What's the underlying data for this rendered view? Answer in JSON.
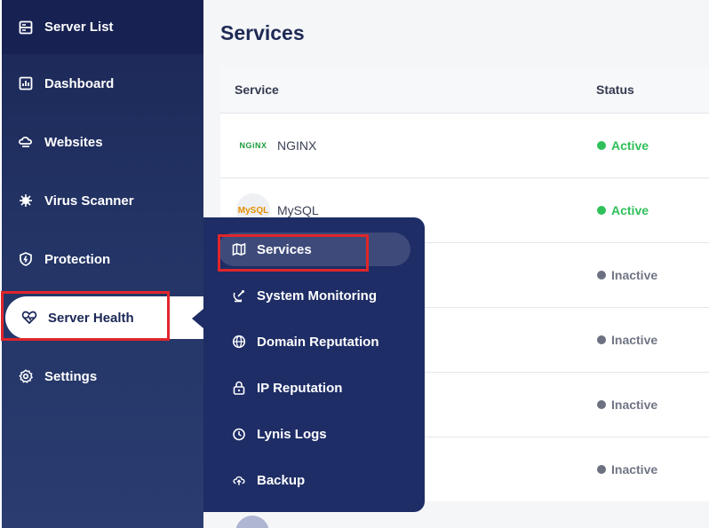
{
  "sidebar": {
    "items": [
      {
        "label": "Server List",
        "icon": "server-list-icon"
      },
      {
        "label": "Dashboard",
        "icon": "chart-icon"
      },
      {
        "label": "Websites",
        "icon": "cloud-icon"
      },
      {
        "label": "Virus Scanner",
        "icon": "virus-icon"
      },
      {
        "label": "Protection",
        "icon": "shield-icon"
      },
      {
        "label": "Server Health",
        "icon": "heart-pulse-icon"
      },
      {
        "label": "Settings",
        "icon": "gear-icon"
      }
    ]
  },
  "main": {
    "title": "Services",
    "table": {
      "headers": {
        "service": "Service",
        "status": "Status"
      },
      "rows": [
        {
          "service": "NGINX",
          "logo": "NGiNX",
          "status": "Active"
        },
        {
          "service": "MySQL",
          "logo": "MySQL",
          "status": "Active"
        },
        {
          "service": "",
          "status": "Inactive"
        },
        {
          "service": "",
          "status": "Inactive"
        },
        {
          "service": "",
          "status": "Inactive"
        },
        {
          "service": "",
          "status": "Inactive"
        }
      ]
    }
  },
  "flyout": {
    "items": [
      {
        "label": "Services",
        "icon": "map-icon"
      },
      {
        "label": "System Monitoring",
        "icon": "satellite-icon"
      },
      {
        "label": "Domain Reputation",
        "icon": "globe-icon"
      },
      {
        "label": "IP Reputation",
        "icon": "lock-icon"
      },
      {
        "label": "Lynis Logs",
        "icon": "history-icon"
      },
      {
        "label": "Backup",
        "icon": "cloud-upload-icon"
      }
    ]
  },
  "colors": {
    "sidebar_bg": "#1b2756",
    "flyout_bg": "#1e2d66",
    "active_status": "#2fc05a",
    "inactive_status": "#707585",
    "highlight": "#e0262b"
  }
}
